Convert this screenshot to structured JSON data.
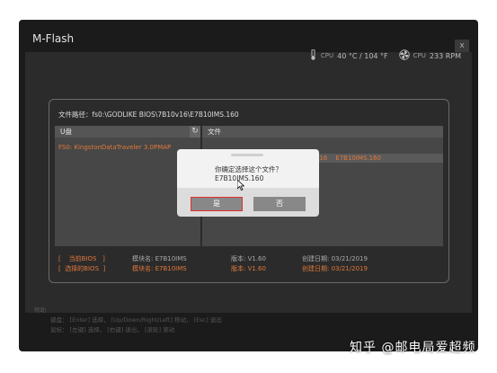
{
  "window": {
    "title": "M-Flash",
    "close_label": "x"
  },
  "sensors": {
    "cpu_temp_label": "CPU",
    "cpu_temp_value": "40 °C / 104 °F",
    "cpu_fan_label": "CPU",
    "cpu_fan_value": "233 RPM",
    "colors": {
      "accent": "#e0783a",
      "highlight": "#e03030"
    }
  },
  "panel": {
    "path": "文件路径：fs0:\\GODLIKE BIOS\\7B10v16\\E7B10IMS.160",
    "drive_header": "U盘",
    "file_header": "文件",
    "drives": [
      "FS0: KingstonDataTraveler 3.0PMAP"
    ],
    "files": [
      {
        "date_part": "216",
        "name": "E7B10IMS.160"
      }
    ],
    "current_bios": {
      "label": "当前BIOS",
      "module": "模块名: E7B10IMS",
      "version": "版本: V1.60",
      "date": "创建日期: 03/21/2019"
    },
    "selected_bios": {
      "label": "选择的BIOS",
      "module": "模块名: E7B10IMS",
      "version": "版本: V1.60",
      "date": "创建日期: 03/21/2019"
    }
  },
  "dialog": {
    "message": "你确定选择这个文件？",
    "filename": "E7B10IMS.160",
    "yes": "是",
    "no": "否"
  },
  "help": {
    "title": "帮助",
    "keyboard": "键盘：  [Enter] 选择，  [Up/Down/Right/Left] 移动，  [Esc] 退出",
    "mouse": "鼠标：  [左键] 选择，  [右键] 退出，  [滚轮] 滚动"
  },
  "watermark": "知乎 @邮电局爱超频"
}
